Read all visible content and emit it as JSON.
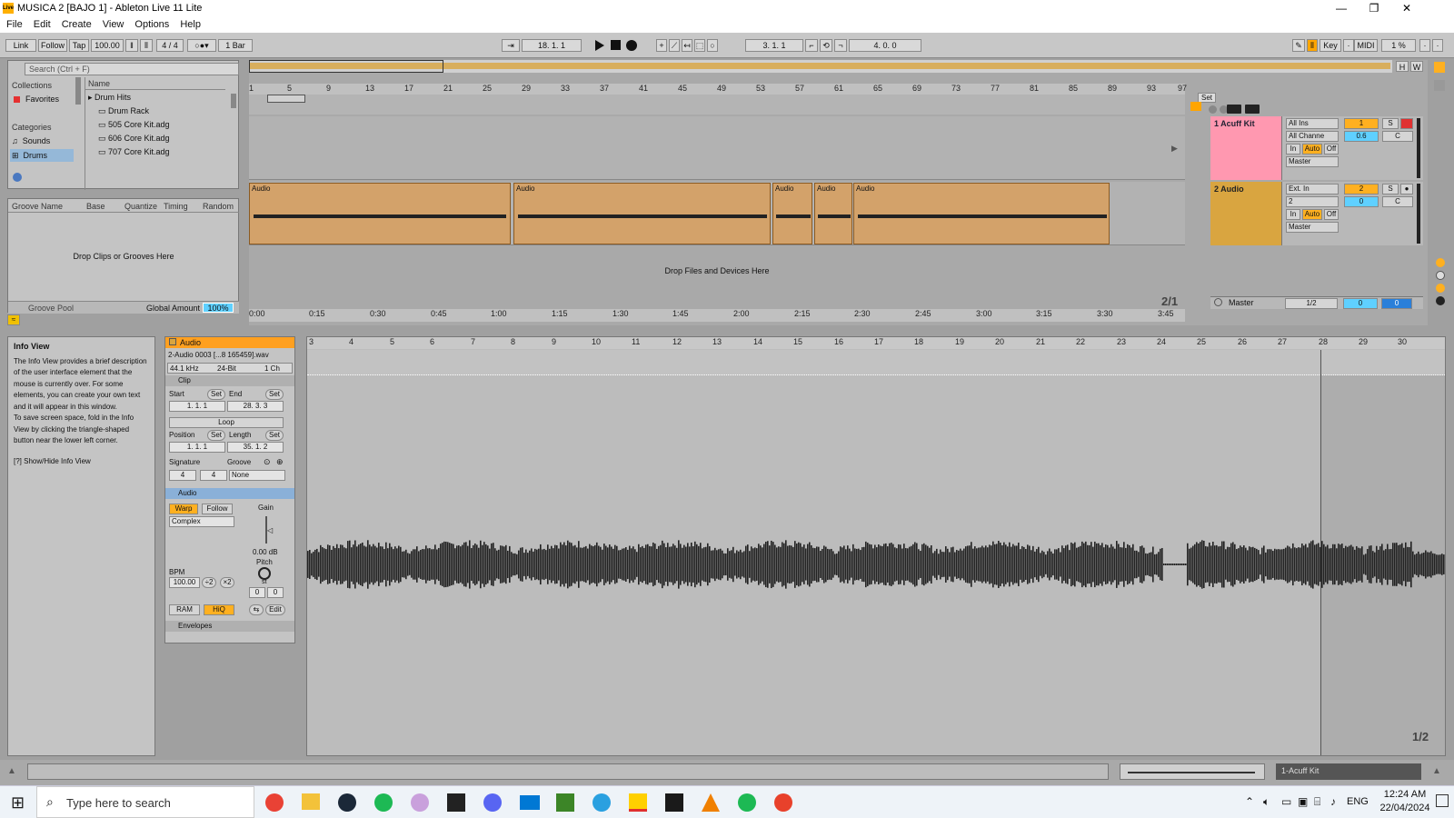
{
  "window": {
    "title": "MUSICA 2  [BAJO 1] - Ableton Live 11 Lite",
    "logo": "Live",
    "min": "—",
    "max": "❐",
    "close": "✕"
  },
  "menu": [
    "File",
    "Edit",
    "Create",
    "View",
    "Options",
    "Help"
  ],
  "transport": {
    "link": "Link",
    "follow": "Follow",
    "tap": "Tap",
    "tempo": "100.00",
    "signature": "4 / 4",
    "quantize": "1 Bar",
    "arrangement_position": "18.  1.  1",
    "loop_start": "3.  1.  1",
    "loop_length": "4.  0.  0",
    "key": "Key",
    "midi": "MIDI",
    "cpu": "1 %"
  },
  "browser": {
    "search_placeholder": "Search (Ctrl + F)",
    "collections_header": "Collections",
    "favorites": "Favorites",
    "categories_header": "Categories",
    "categories": [
      "Sounds",
      "Drums"
    ],
    "name_header": "Name",
    "items": [
      "Drum Hits",
      "Drum Rack",
      "505 Core Kit.adg",
      "606 Core Kit.adg",
      "707 Core Kit.adg"
    ]
  },
  "groove": {
    "columns": [
      "Groove Name",
      "Base",
      "Quantize",
      "Timing",
      "Random"
    ],
    "drop_hint": "Drop Clips or Grooves Here",
    "pool_label": "Groove Pool",
    "global_amount_label": "Global Amount",
    "global_amount": "100%"
  },
  "arrange": {
    "bar_ruler": [
      "1",
      "5",
      "9",
      "13",
      "17",
      "21",
      "25",
      "29",
      "33",
      "37",
      "41",
      "45",
      "49",
      "53",
      "57",
      "61",
      "65",
      "69",
      "73",
      "77",
      "81",
      "85",
      "89",
      "93",
      "97"
    ],
    "time_ruler": [
      "0:00",
      "0:15",
      "0:30",
      "0:45",
      "1:00",
      "1:15",
      "1:30",
      "1:45",
      "2:00",
      "2:15",
      "2:30",
      "2:45",
      "3:00",
      "3:15",
      "3:30",
      "3:45"
    ],
    "set_label": "Set",
    "clips": [
      "Audio",
      "Audio",
      "Audio",
      "Audio",
      "Audio"
    ],
    "drop_hint": "Drop Files and Devices Here",
    "fraction": "2/1",
    "tracks": [
      {
        "name": "1 Acuff Kit",
        "input": "All Ins",
        "channel": "All Channe",
        "in": "In",
        "auto": "Auto",
        "off": "Off",
        "output": "Master",
        "number": "1",
        "solo": "S",
        "volume": "0.6",
        "pan": "C",
        "color": "#ff98b0"
      },
      {
        "name": "2 Audio",
        "input": "Ext. In",
        "channel": "2",
        "in": "In",
        "auto": "Auto",
        "off": "Off",
        "output": "Master",
        "number": "2",
        "solo": "S",
        "volume": "0",
        "pan": "C",
        "color": "#d9a540"
      },
      {
        "name": "Master",
        "input": "1/2",
        "volume": "0",
        "pan": "0"
      }
    ],
    "h_btn": "H",
    "w_btn": "W"
  },
  "info": {
    "title": "Info View",
    "body": "The Info View provides a brief description of the user interface element that the mouse is currently over. For some elements, you can create your own text and it will appear in this window.",
    "body2": "To save screen space, fold in the Info View by clicking the triangle-shaped button near the lower left corner.",
    "shortcut": "[?] Show/Hide Info View"
  },
  "clip": {
    "name": "Audio",
    "file": "2-Audio 0003 [...8 165459].wav",
    "sample_rate": "44.1 kHz",
    "bit_depth": "24-Bit",
    "channels": "1 Ch",
    "section": "Clip",
    "start_label": "Start",
    "end_label": "End",
    "set": "Set",
    "start": "1.   1.   1",
    "end": "28.   3.   3",
    "loop": "Loop",
    "position_label": "Position",
    "length_label": "Length",
    "position": "1.   1.   1",
    "length": "35.   1.   2",
    "signature_label": "Signature",
    "groove_label": "Groove",
    "sig_num": "4",
    "sig_den": "4",
    "groove": "None",
    "audio_section": "Audio",
    "warp": "Warp",
    "follow": "Follow",
    "gain_label": "Gain",
    "warp_mode": "Complex",
    "gain": "0.00 dB",
    "pitch_label": "Pitch",
    "bpm_label": "BPM",
    "bpm": "100.00",
    "half": "÷2",
    "double": "×2",
    "st": "st",
    "semi": "0",
    "cents": "0",
    "ram": "RAM",
    "hiq": "HiQ",
    "edit": "Edit",
    "envelopes": "Envelopes"
  },
  "sample": {
    "ruler": [
      "3",
      "4",
      "5",
      "6",
      "7",
      "8",
      "9",
      "10",
      "11",
      "12",
      "13",
      "14",
      "15",
      "16",
      "17",
      "18",
      "19",
      "20",
      "21",
      "22",
      "23",
      "24",
      "25",
      "26",
      "27",
      "28",
      "29",
      "30"
    ],
    "fraction": "1/2"
  },
  "status": {
    "track": "1-Acuff Kit"
  },
  "taskbar": {
    "search_placeholder": "Type here to search",
    "lang": "ENG",
    "time": "12:24 AM",
    "date": "22/04/2024"
  }
}
